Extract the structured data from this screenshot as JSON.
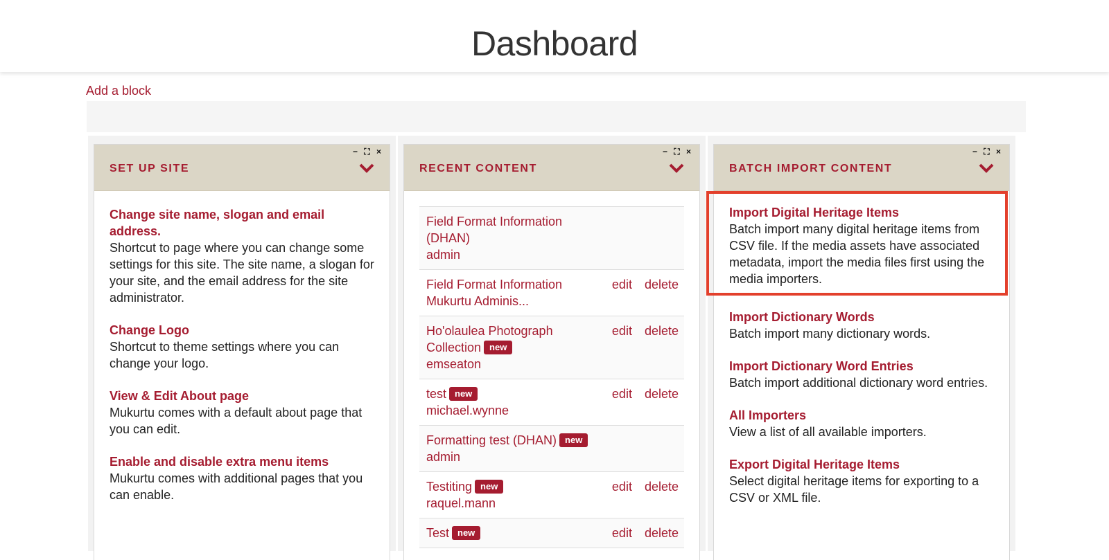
{
  "header": {
    "title": "Dashboard"
  },
  "add_block_label": "Add a block",
  "panes": {
    "setup": {
      "title": "SET UP SITE",
      "tasks": [
        {
          "link": "Change site name, slogan and email address.",
          "desc": "Shortcut to page where you can change some settings for this site. The site name, a slogan for your site, and the email address for the site administrator."
        },
        {
          "link": "Change Logo",
          "desc": "Shortcut to theme settings where you can change your logo."
        },
        {
          "link": "View & Edit About page",
          "desc": "Mukurtu comes with a default about page that you can edit."
        },
        {
          "link": "Enable and disable extra menu items",
          "desc": "Mukurtu comes with additional pages that you can enable."
        }
      ]
    },
    "recent": {
      "title": "RECENT CONTENT",
      "edit_label": "edit",
      "delete_label": "delete",
      "new_label": "new",
      "items": [
        {
          "title": "Field Format Information (DHAN)",
          "author": "admin"
        },
        {
          "title": "Field Format Information",
          "author": "Mukurtu Adminis..."
        },
        {
          "title": "Ho'olaulea Photograph Collection",
          "author": "emseaton"
        },
        {
          "title": "test",
          "author": "michael.wynne"
        },
        {
          "title": "Formatting test (DHAN)",
          "author": "admin"
        },
        {
          "title": "Testiting",
          "author": "raquel.mann"
        },
        {
          "title": "Test",
          "author": ""
        }
      ]
    },
    "batch": {
      "title": "BATCH IMPORT CONTENT",
      "tasks": [
        {
          "link": "Import Digital Heritage Items",
          "desc": "Batch import many digital heritage items from CSV file. If the media assets have associated metadata, import the media files first using the media importers."
        },
        {
          "link": "Import Dictionary Words",
          "desc": "Batch import many dictionary words."
        },
        {
          "link": "Import Dictionary Word Entries",
          "desc": "Batch import additional dictionary word entries."
        },
        {
          "link": "All Importers",
          "desc": "View a list of all available importers."
        },
        {
          "link": "Export Digital Heritage Items",
          "desc": "Select digital heritage items for exporting to a CSV or XML file."
        }
      ]
    }
  },
  "pane_controls": {
    "minimize": "−",
    "fullscreen": "⛶",
    "close": "×"
  },
  "colors": {
    "accent": "#a51c30",
    "pane_header": "#dbd6c6",
    "highlight": "#e3402c"
  }
}
